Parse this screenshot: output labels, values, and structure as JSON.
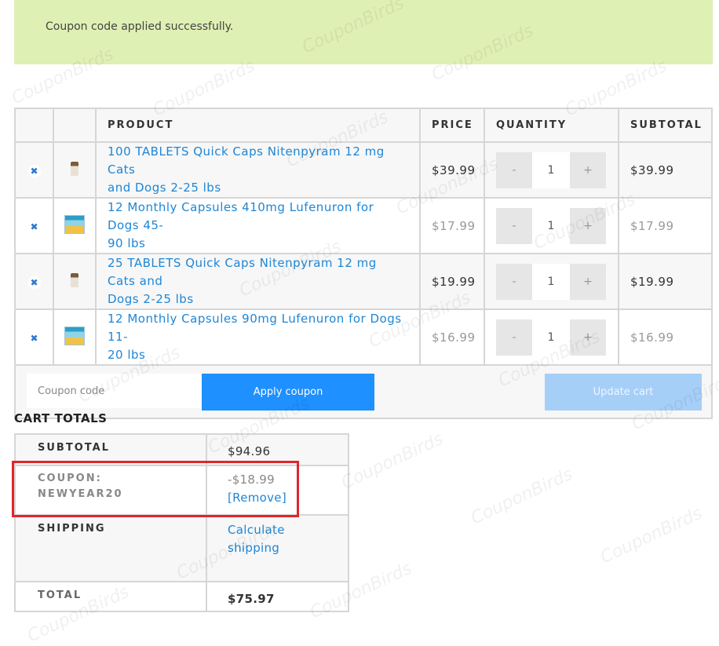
{
  "notice": {
    "message": "Coupon code applied successfully."
  },
  "cart": {
    "headers": {
      "product": "PRODUCT",
      "price": "PRICE",
      "quantity": "QUANTITY",
      "subtotal": "SUBTOTAL"
    },
    "items": [
      {
        "name_line1": "100 TABLETS Quick Caps Nitenpyram 12 mg Cats",
        "name_line2": "and Dogs 2-25 lbs",
        "price": "$39.99",
        "qty": "1",
        "subtotal": "$39.99",
        "thumb": "bottle-thumbnail"
      },
      {
        "name_line1": "12 Monthly Capsules 410mg Lufenuron for Dogs 45-",
        "name_line2": "90 lbs",
        "price": "$17.99",
        "qty": "1",
        "subtotal": "$17.99",
        "thumb": "box-thumbnail"
      },
      {
        "name_line1": "25 TABLETS Quick Caps Nitenpyram 12 mg Cats and",
        "name_line2": "Dogs 2-25 lbs",
        "price": "$19.99",
        "qty": "1",
        "subtotal": "$19.99",
        "thumb": "bottle-thumbnail"
      },
      {
        "name_line1": "12 Monthly Capsules 90mg Lufenuron for Dogs 11-",
        "name_line2": "20 lbs",
        "price": "$16.99",
        "qty": "1",
        "subtotal": "$16.99",
        "thumb": "box-thumbnail"
      }
    ],
    "qty_minus": "-",
    "qty_plus": "+",
    "remove_icon": "✖",
    "coupon_placeholder": "Coupon code",
    "apply_label": "Apply coupon",
    "update_label": "Update cart"
  },
  "totals": {
    "title": "CART TOTALS",
    "subtotal_label": "SUBTOTAL",
    "subtotal_value": "$94.96",
    "coupon_label_1": "COUPON:",
    "coupon_label_2": "NEWYEAR20",
    "coupon_value": "-$18.99",
    "remove_label": "[Remove]",
    "shipping_label": "SHIPPING",
    "shipping_link_1": "Calculate",
    "shipping_link_2": "shipping",
    "total_label": "TOTAL",
    "total_value": "$75.97"
  },
  "watermark": "CouponBirds",
  "colors": {
    "accent": "#1e86d6",
    "button": "#1e90ff",
    "notice_bg": "#dff0b4",
    "highlight": "#e0262c"
  }
}
